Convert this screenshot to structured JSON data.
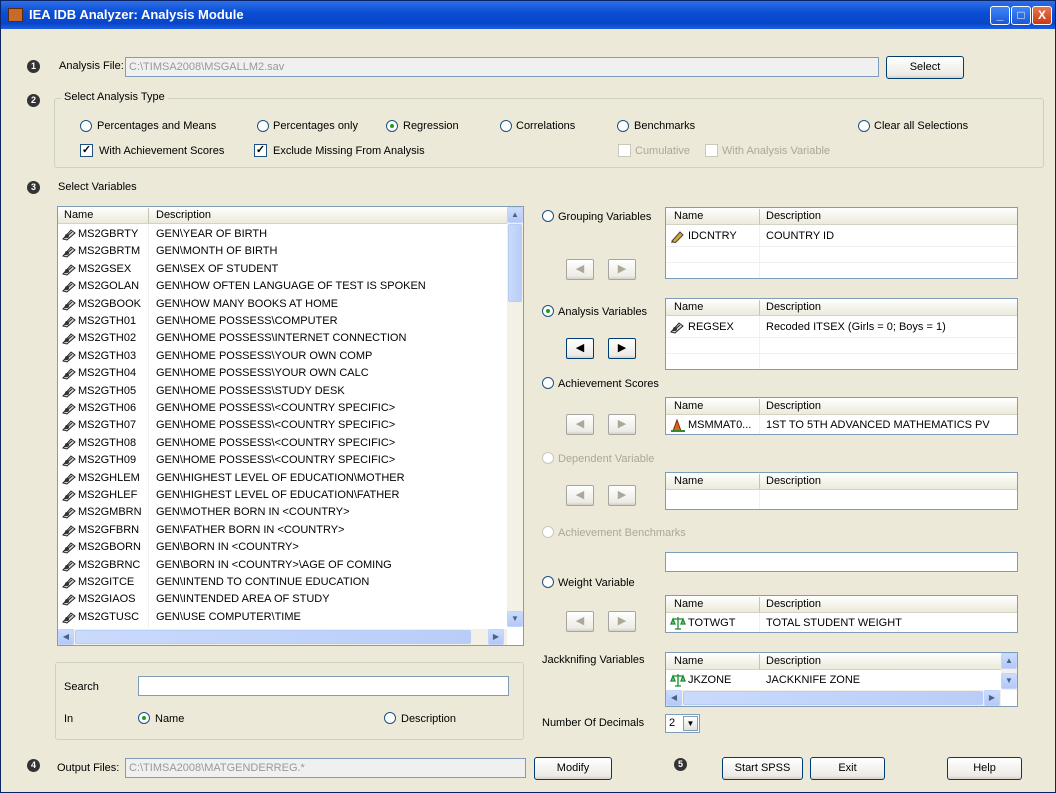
{
  "window": {
    "title": "IEA IDB Analyzer: Analysis Module",
    "minimize": "_",
    "maximize": "□",
    "close": "X"
  },
  "steps": {
    "s1": "1",
    "s2": "2",
    "s3": "3",
    "s4": "4",
    "s5": "5"
  },
  "analysis_file": {
    "label": "Analysis File:",
    "value": "C:\\TIMSA2008\\MSGALLM2.sav",
    "button": "Select"
  },
  "analysis_type": {
    "title": "Select Analysis Type",
    "options": [
      "Percentages and Means",
      "Percentages only",
      "Regression",
      "Correlations",
      "Benchmarks",
      "Clear all Selections"
    ],
    "selected": "Regression",
    "with_achievement": "With Achievement Scores",
    "exclude_missing": "Exclude Missing From Analysis",
    "cumulative": "Cumulative",
    "with_analysis_var": "With Analysis Variable"
  },
  "select_variables": {
    "label": "Select Variables"
  },
  "variable_list": {
    "col_name": "Name",
    "col_desc": "Description",
    "rows": [
      {
        "name": "MS2GBRTY",
        "desc": "GEN\\YEAR OF BIRTH"
      },
      {
        "name": "MS2GBRTM",
        "desc": "GEN\\MONTH OF BIRTH"
      },
      {
        "name": "MS2GSEX",
        "desc": "GEN\\SEX OF STUDENT"
      },
      {
        "name": "MS2GOLAN",
        "desc": "GEN\\HOW OFTEN LANGUAGE OF TEST IS SPOKEN"
      },
      {
        "name": "MS2GBOOK",
        "desc": "GEN\\HOW MANY BOOKS AT HOME"
      },
      {
        "name": "MS2GTH01",
        "desc": "GEN\\HOME POSSESS\\COMPUTER"
      },
      {
        "name": "MS2GTH02",
        "desc": "GEN\\HOME POSSESS\\INTERNET CONNECTION"
      },
      {
        "name": "MS2GTH03",
        "desc": "GEN\\HOME POSSESS\\YOUR OWN COMP"
      },
      {
        "name": "MS2GTH04",
        "desc": "GEN\\HOME POSSESS\\YOUR OWN CALC"
      },
      {
        "name": "MS2GTH05",
        "desc": "GEN\\HOME POSSESS\\STUDY DESK"
      },
      {
        "name": "MS2GTH06",
        "desc": "GEN\\HOME POSSESS\\<COUNTRY SPECIFIC>"
      },
      {
        "name": "MS2GTH07",
        "desc": "GEN\\HOME POSSESS\\<COUNTRY SPECIFIC>"
      },
      {
        "name": "MS2GTH08",
        "desc": "GEN\\HOME POSSESS\\<COUNTRY SPECIFIC>"
      },
      {
        "name": "MS2GTH09",
        "desc": "GEN\\HOME POSSESS\\<COUNTRY SPECIFIC>"
      },
      {
        "name": "MS2GHLEM",
        "desc": "GEN\\HIGHEST LEVEL OF EDUCATION\\MOTHER"
      },
      {
        "name": "MS2GHLEF",
        "desc": "GEN\\HIGHEST LEVEL OF EDUCATION\\FATHER"
      },
      {
        "name": "MS2GMBRN",
        "desc": "GEN\\MOTHER BORN IN <COUNTRY>"
      },
      {
        "name": "MS2GFBRN",
        "desc": "GEN\\FATHER BORN IN <COUNTRY>"
      },
      {
        "name": "MS2GBORN",
        "desc": "GEN\\BORN IN <COUNTRY>"
      },
      {
        "name": "MS2GBRNC",
        "desc": "GEN\\BORN IN <COUNTRY>\\AGE OF COMING"
      },
      {
        "name": "MS2GITCE",
        "desc": "GEN\\INTEND TO CONTINUE EDUCATION"
      },
      {
        "name": "MS2GIAOS",
        "desc": "GEN\\INTENDED AREA OF STUDY"
      },
      {
        "name": "MS2GTUSC",
        "desc": "GEN\\USE COMPUTER\\TIME"
      }
    ]
  },
  "search": {
    "label": "Search",
    "value": "",
    "in_label": "In",
    "opt_name": "Name",
    "opt_desc": "Description",
    "selected": "Name"
  },
  "grouping": {
    "label": "Grouping Variables",
    "col_name": "Name",
    "col_desc": "Description",
    "rows": [
      {
        "name": "IDCNTRY",
        "desc": "COUNTRY ID"
      }
    ]
  },
  "analysis_vars": {
    "label": "Analysis Variables",
    "col_name": "Name",
    "col_desc": "Description",
    "rows": [
      {
        "name": "REGSEX",
        "desc": "Recoded ITSEX (Girls = 0; Boys = 1)"
      }
    ]
  },
  "achievement": {
    "label": "Achievement Scores",
    "col_name": "Name",
    "col_desc": "Description",
    "rows": [
      {
        "name": "MSMMAT0...",
        "desc": "1ST TO 5TH ADVANCED MATHEMATICS PV"
      }
    ]
  },
  "dependent": {
    "label": "Dependent Variable",
    "col_name": "Name",
    "col_desc": "Description"
  },
  "benchmarks": {
    "label": "Achievement Benchmarks"
  },
  "weight": {
    "label": "Weight Variable",
    "col_name": "Name",
    "col_desc": "Description",
    "rows": [
      {
        "name": "TOTWGT",
        "desc": "TOTAL STUDENT WEIGHT"
      }
    ]
  },
  "jackknife": {
    "label": "Jackknifing Variables",
    "col_name": "Name",
    "col_desc": "Description",
    "rows": [
      {
        "name": "JKZONE",
        "desc": "JACKKNIFE ZONE"
      }
    ]
  },
  "decimals": {
    "label": "Number Of Decimals",
    "value": "2"
  },
  "arrows": {
    "left": "◀",
    "right": "▶"
  },
  "output": {
    "label": "Output Files:",
    "value": "C:\\TIMSA2008\\MATGENDERREG.*",
    "modify": "Modify"
  },
  "actions": {
    "start": "Start SPSS",
    "exit": "Exit",
    "help": "Help"
  }
}
